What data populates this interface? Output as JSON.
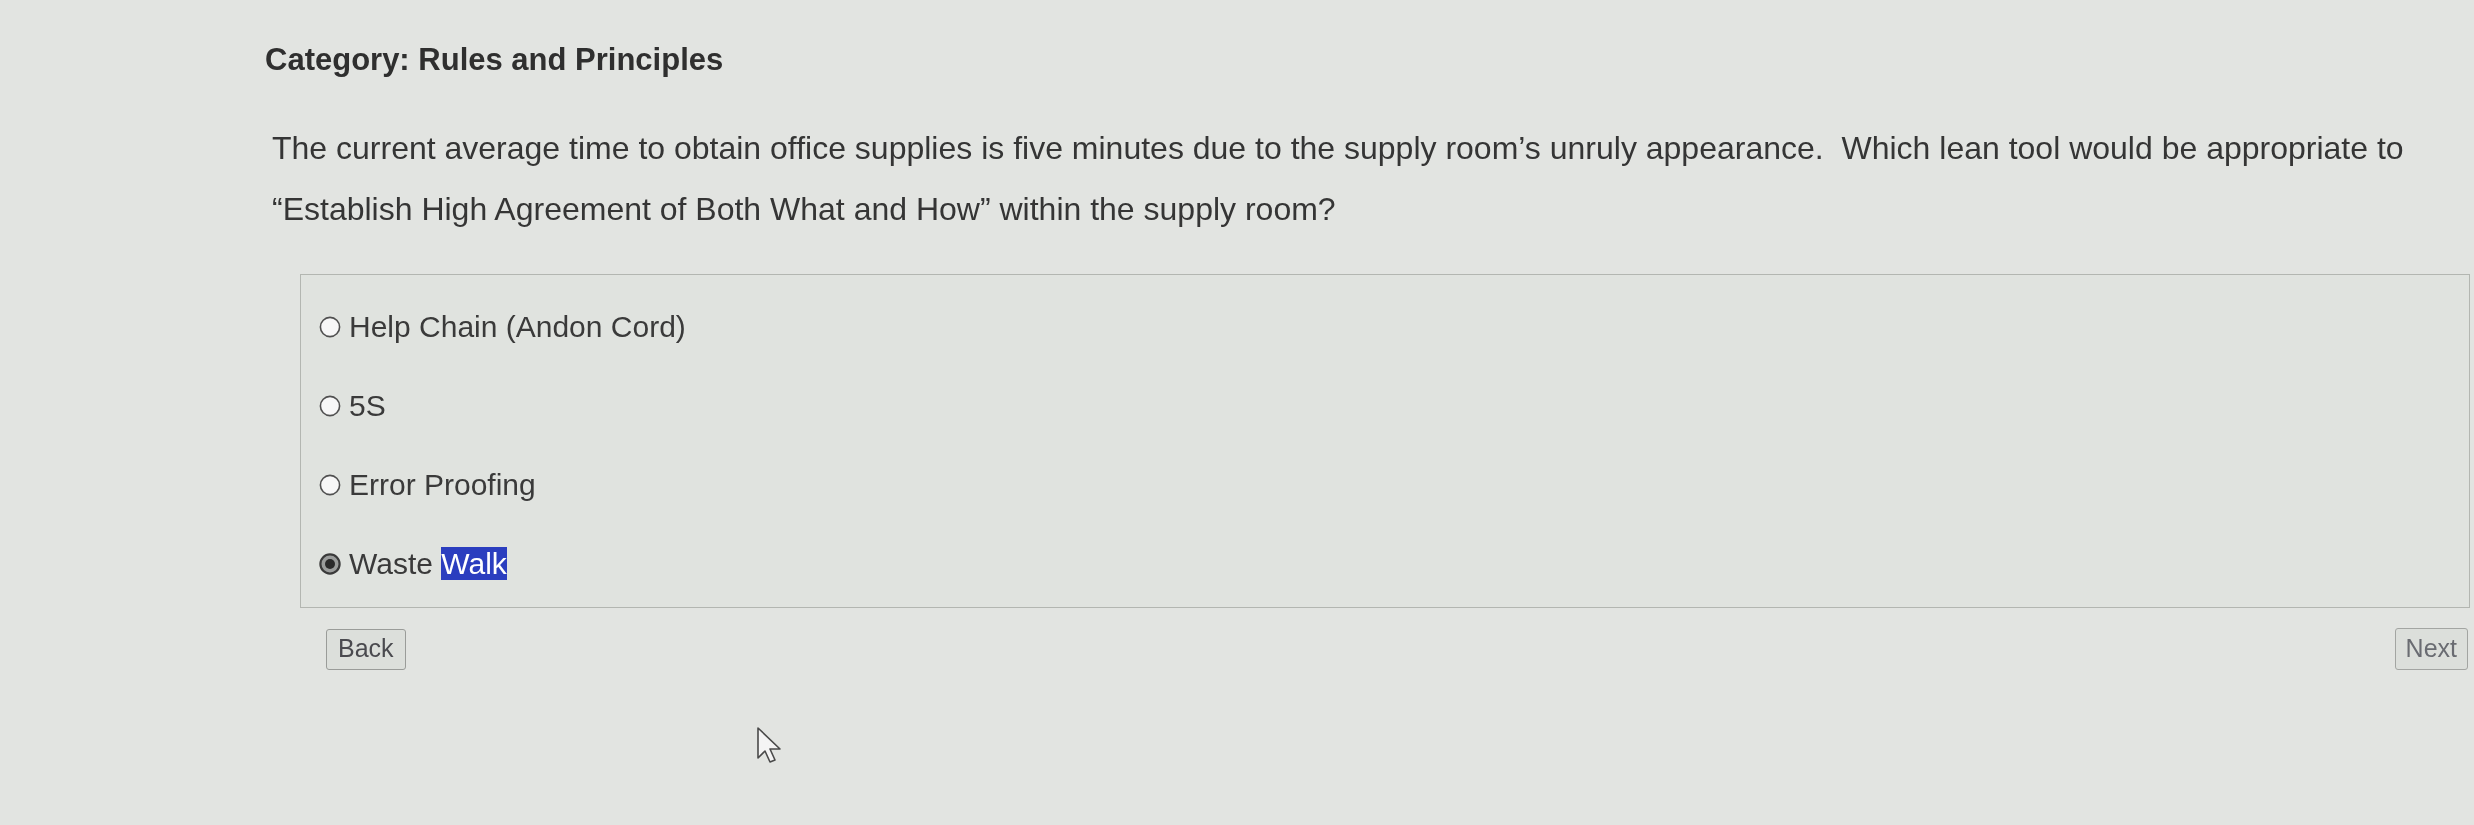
{
  "heading": "Category: Rules and Principles",
  "question": {
    "text": "The current average time to obtain office supplies is five minutes due to the supply room’s unruly appearance.  Which lean tool would be appropriate to “Establish High Agreement of Both What and How” within the supply room?",
    "options": [
      {
        "label_runs": [
          {
            "text": "Help Chain (Andon Cord)",
            "highlighted": false
          }
        ],
        "selected": false
      },
      {
        "label_runs": [
          {
            "text": "5S",
            "highlighted": false
          }
        ],
        "selected": false
      },
      {
        "label_runs": [
          {
            "text": "Error Proofing",
            "highlighted": false
          }
        ],
        "selected": false
      },
      {
        "label_runs": [
          {
            "text": "Waste ",
            "highlighted": false
          },
          {
            "text": "Walk",
            "highlighted": true
          }
        ],
        "selected": true
      }
    ]
  },
  "navigation": {
    "back": {
      "label": "Back"
    },
    "next": {
      "label": "Next"
    }
  }
}
